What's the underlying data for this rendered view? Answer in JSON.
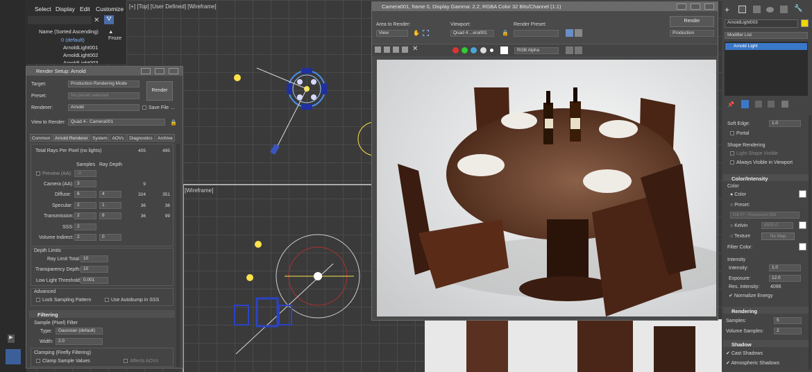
{
  "menu": {
    "items": [
      "Select",
      "Display",
      "Edit",
      "Customize"
    ]
  },
  "scene": {
    "column_header": "Name (Sorted Ascending)",
    "frozen_header": "▲ Froze",
    "rows": [
      "0 (default)",
      "ArnoldLight001",
      "ArnoldLight002",
      "ArnoldLight003"
    ]
  },
  "viewports": {
    "top_label": "[+] [Top] [User Defined] [Wireframe]",
    "wire_label": "[Wireframe]"
  },
  "render_setup": {
    "title": "Render Setup: Arnold",
    "target_label": "Target:",
    "target_value": "Production Rendering Mode",
    "preset_label": "Preset:",
    "preset_value": "No preset selected",
    "renderer_label": "Renderer:",
    "renderer_value": "Arnold",
    "save_file": "Save File",
    "ellipsis": "...",
    "render_button": "Render",
    "view_label": "View to Render:",
    "view_value": "Quad 4 - Camera001",
    "tabs": [
      "Common",
      "Arnold Renderer",
      "System",
      "AOVs",
      "Diagnostics",
      "Archive"
    ],
    "total_rays_label": "Total Rays Per Pixel (no lights)",
    "total_rays_a": "405",
    "total_rays_b": "495",
    "col_samples": "Samples",
    "col_ray_depth": "Ray Depth",
    "preview_label": "Preview (AA):",
    "preview_value": "-3",
    "camera_label": "Camera (AA):",
    "camera_value": "3",
    "camera_total": "9",
    "diffuse_label": "Diffuse:",
    "diffuse_s": "6",
    "diffuse_d": "4",
    "diffuse_a": "324",
    "diffuse_b": "351",
    "specular_label": "Specular:",
    "specular_s": "2",
    "specular_d": "1",
    "specular_a": "36",
    "specular_b": "36",
    "transmission_label": "Transmission:",
    "transmission_s": "2",
    "transmission_d": "8",
    "transmission_a": "36",
    "transmission_b": "99",
    "sss_label": "SSS:",
    "sss_s": "2",
    "volume_label": "Volume Indirect:",
    "volume_s": "2",
    "volume_d": "0",
    "depth_limits": "Depth Limits",
    "ray_limit_label": "Ray Limit Total:",
    "ray_limit_value": "10",
    "transparency_label": "Transparency Depth:",
    "transparency_value": "10",
    "low_light_label": "Low Light Threshold:",
    "low_light_value": "0.001",
    "advanced": "Advanced",
    "lock_sampling": "Lock Sampling Pattern",
    "autobump": "Use Autobump in SSS",
    "filtering": "Filtering",
    "sample_filter": "Sample (Pixel) Filter",
    "type_label": "Type:",
    "type_value": "Gaussian (default)",
    "width_label": "Width:",
    "width_value": "2.0",
    "clamping": "Clamping (Firefly Filtering)",
    "clamp_values": "Clamp Sample Values",
    "affect_aovs": "Affects AOVs"
  },
  "frame_window": {
    "title": "Camera001, frame 0, Display Gamma: 2.2, RGBA Color 32 Bits/Channel (1:1)",
    "area_label": "Area to Render:",
    "area_value": "View",
    "viewport_label": "Viewport:",
    "viewport_value": "Quad 4 ...era001",
    "preset_label": "Render Preset:",
    "preset_value": "",
    "render_button": "Render",
    "production_value": "Production",
    "channel_value": "RGB Alpha"
  },
  "modify": {
    "object_name": "ArnoldLight003",
    "modifier_list": "Modifier List",
    "stack_item": "Arnold Light",
    "soft_edge_label": "Soft Edge:",
    "soft_edge_value": "1.0",
    "portal": "Portal",
    "shape_rendering": "Shape Rendering",
    "light_shape_visible": "Light Shape Visible",
    "always_visible": "Always Visible in Viewport",
    "color_intensity": "Color/Intensity",
    "color_group": "Color",
    "color_radio": "Color",
    "preset_label": "Preset:",
    "preset_value": "CIE F7 - Fluorescent D65",
    "kelvin_label": "Kelvin",
    "kelvin_value": "6500.0",
    "texture_label": "Texture",
    "no_map": "No Map",
    "filter_color": "Filter Color:",
    "intensity_group": "Intensity",
    "intensity_label": "Intensity:",
    "intensity_value": "1.0",
    "exposure_label": "Exposure:",
    "exposure_value": "12.0",
    "res_intensity_label": "Res. Intensity:",
    "res_intensity_value": "4096",
    "normalize": "Normalize Energy",
    "rendering": "Rendering",
    "samples_label": "Samples:",
    "samples_value": "5",
    "volume_samples_label": "Volume Samples:",
    "volume_samples_value": "2",
    "shadow": "Shadow",
    "cast_shadows": "Cast Shadows",
    "atmospheric_shadows": "Atmospheric Shadows"
  },
  "colors": {
    "accent": "#4a6ea8",
    "highlight": "#3a78c8",
    "viewport_bg": "#3a3a3a"
  }
}
